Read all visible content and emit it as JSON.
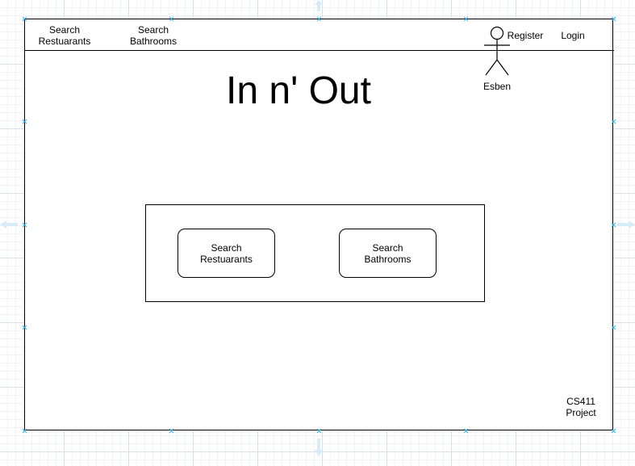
{
  "nav": {
    "search_restaurants": "Search\nRestuarants",
    "search_bathrooms": "Search\nBathrooms",
    "register": "Register",
    "login": "Login"
  },
  "user": {
    "name": "Esben"
  },
  "page": {
    "title": "In n' Out"
  },
  "panel": {
    "search_restaurants_button": "Search\nRestuarants",
    "search_bathrooms_button": "Search\nBathrooms"
  },
  "footer": {
    "project_label": "CS411\nProject"
  },
  "colors": {
    "selection_handle": "#29b6f2",
    "grid_line": "#d9e0e7",
    "stroke": "#000000"
  }
}
